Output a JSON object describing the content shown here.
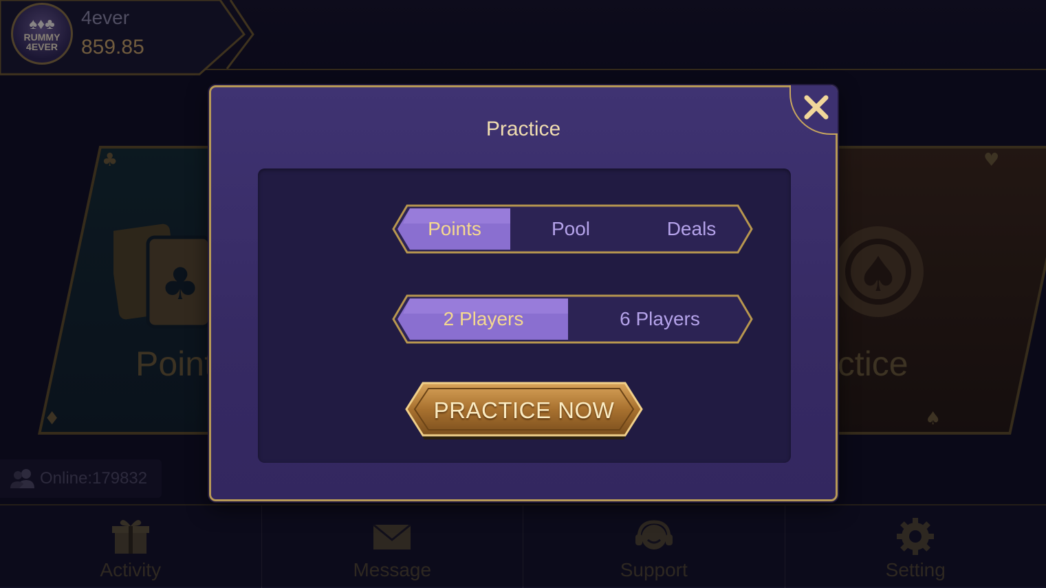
{
  "profile": {
    "logo_text_top": "RUMMY",
    "logo_text_bottom": "4EVER",
    "username": "4ever",
    "balance": "859.85"
  },
  "lobby": {
    "left_card_title": "Point",
    "right_card_title": "actice"
  },
  "online": {
    "label": "Online:179832"
  },
  "nav": {
    "items": [
      {
        "label": "Activity",
        "icon": "gift-icon"
      },
      {
        "label": "Message",
        "icon": "envelope-icon"
      },
      {
        "label": "Support",
        "icon": "headset-icon"
      },
      {
        "label": "Setting",
        "icon": "gear-icon"
      }
    ]
  },
  "modal": {
    "title": "Practice",
    "game_types": [
      "Points",
      "Pool",
      "Deals"
    ],
    "selected_game_type": "Points",
    "player_counts": [
      "2 Players",
      "6 Players"
    ],
    "selected_player_count": "2 Players",
    "action_label": "PRACTICE NOW"
  },
  "colors": {
    "accent_gold": "#c9a75e",
    "modal_bg": "#3a2e6a",
    "segment_active": "#8a6fd0",
    "button_gold": "#b9803a"
  }
}
